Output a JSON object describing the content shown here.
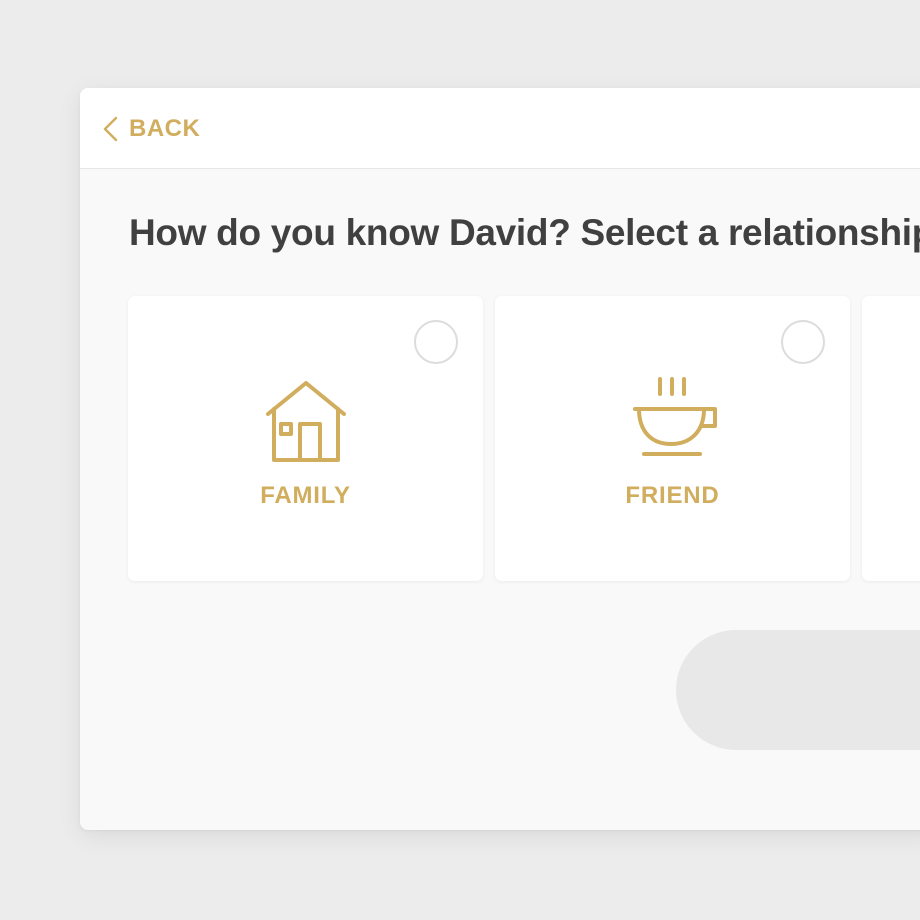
{
  "header": {
    "back_label": "BACK"
  },
  "main": {
    "question": "How do you know David? Select a relationship",
    "options": [
      {
        "label": "FAMILY",
        "icon": "house-icon",
        "selected": false
      },
      {
        "label": "FRIEND",
        "icon": "coffee-cup-icon",
        "selected": false
      },
      {
        "label": "",
        "icon": "",
        "selected": false
      }
    ]
  },
  "colors": {
    "accent": "#d1ad5e",
    "heading": "#404040",
    "background": "#ececec",
    "panel": "#f9f9f9",
    "card": "#ffffff",
    "radio_border": "#dcdcdc",
    "button_disabled": "#e8e8e8"
  }
}
